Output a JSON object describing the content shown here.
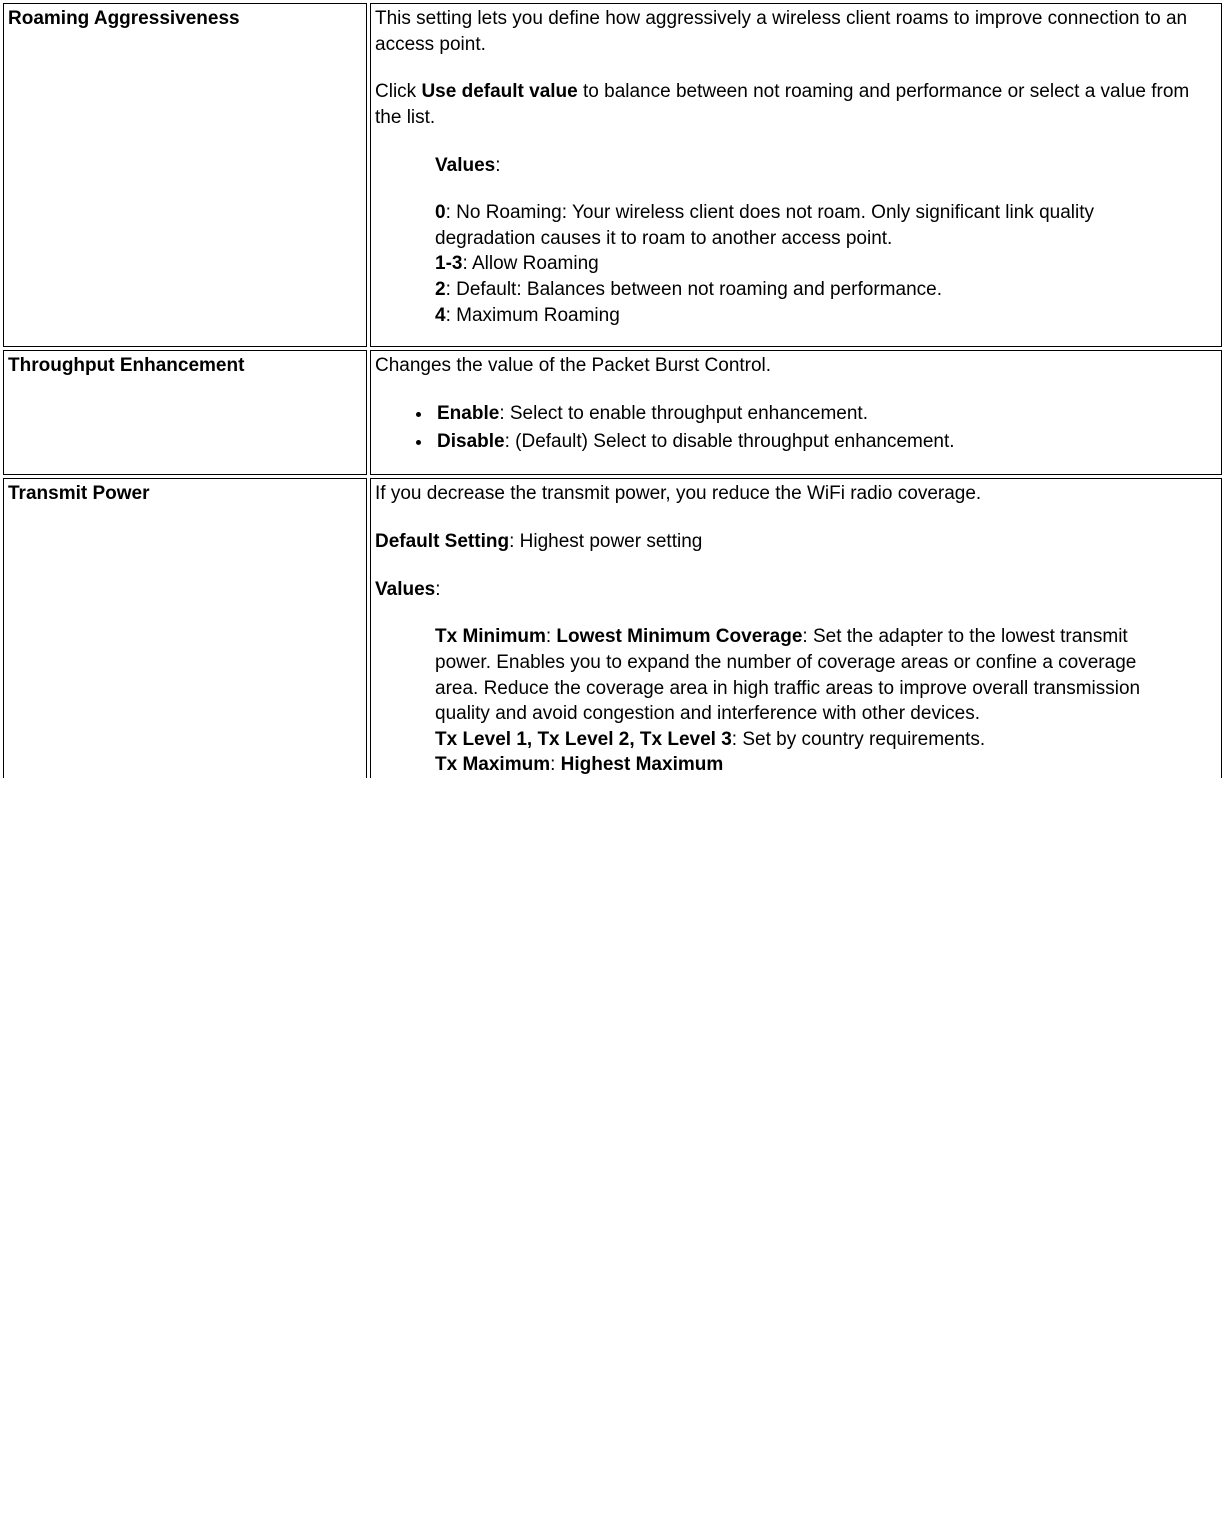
{
  "rows": [
    {
      "name": "Roaming Aggressiveness",
      "intro": "This setting lets you define how aggressively a wireless client roams to improve connection to an access point.",
      "click_prefix": "Click ",
      "click_bold": "Use default value",
      "click_suffix": " to balance between not roaming and performance or select a value from the list.",
      "values_label": "Values",
      "values": [
        {
          "key": "0",
          "text": ": No Roaming: Your wireless client does not roam. Only significant link quality degradation causes it to roam to another access point."
        },
        {
          "key": "1-3",
          "text": ": Allow Roaming"
        },
        {
          "key": "2",
          "text": ": Default: Balances between not roaming and performance."
        },
        {
          "key": "4",
          "text": ": Maximum Roaming"
        }
      ]
    },
    {
      "name": "Throughput Enhancement",
      "intro": "Changes the value of the Packet Burst Control.",
      "bullets": [
        {
          "key": "Enable",
          "text": ": Select to enable throughput enhancement."
        },
        {
          "key": "Disable",
          "text": ": (Default) Select to disable throughput enhancement."
        }
      ]
    },
    {
      "name": "Transmit Power",
      "intro": "If you decrease the transmit power, you reduce the WiFi radio coverage.",
      "default_label": "Default Setting",
      "default_value": ": Highest power setting",
      "values_label": "Values",
      "tx_min_bold1": "Tx Minimum",
      "tx_min_sep": ": ",
      "tx_min_bold2": "Lowest Minimum Coverage",
      "tx_min_text": ": Set the adapter to the lowest transmit power. Enables you to expand the number of coverage areas or confine a coverage area. Reduce the coverage area in high traffic areas to improve overall transmission quality and avoid congestion and interference with other devices.",
      "tx_levels_bold": "Tx Level 1, Tx Level 2, Tx Level 3",
      "tx_levels_text": ": Set by country requirements.",
      "tx_max_bold1": "Tx Maximum",
      "tx_max_sep": ": ",
      "tx_max_bold2": "Highest Maximum"
    }
  ]
}
